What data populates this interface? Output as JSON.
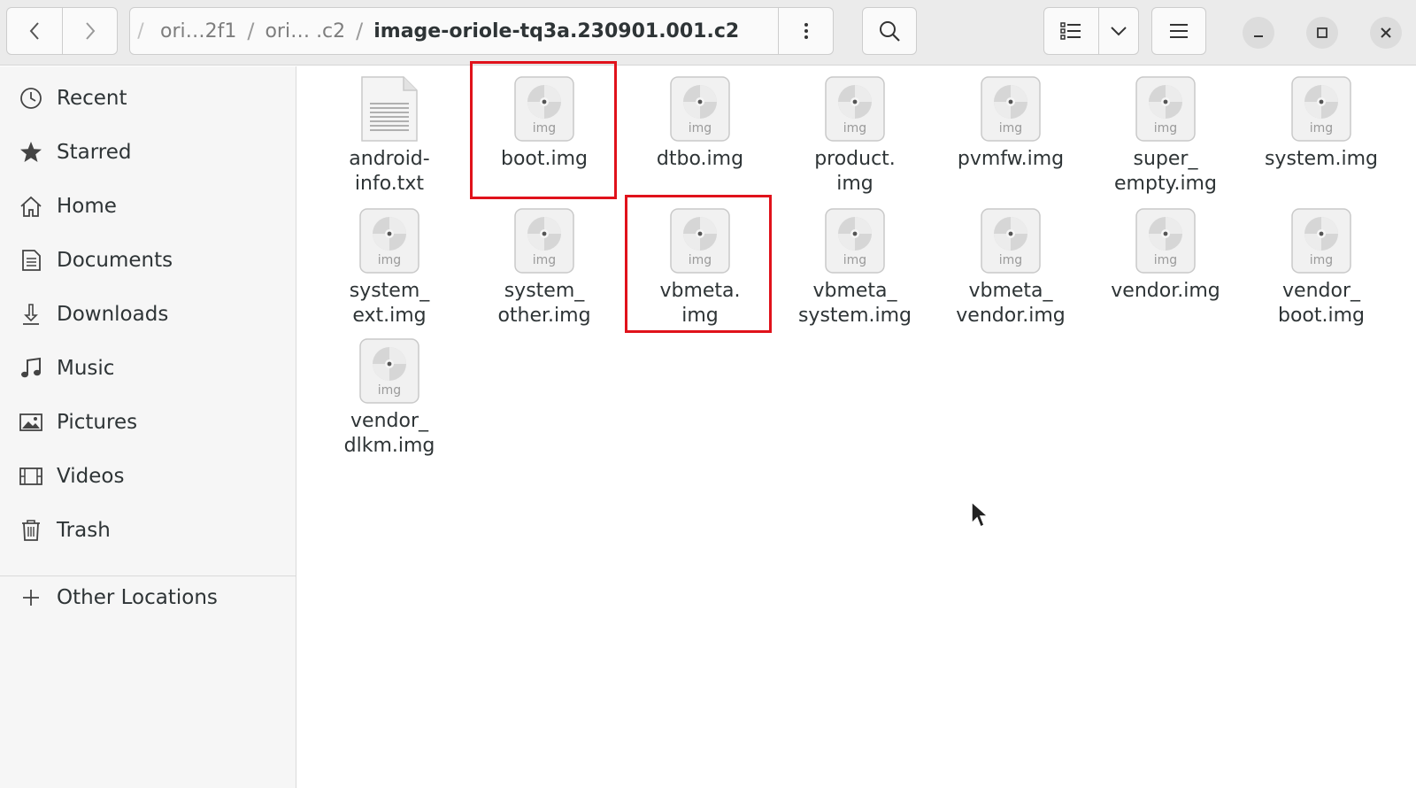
{
  "header": {
    "breadcrumbs": [
      "ori…2f1",
      "ori… .c2",
      "image-oriole-tq3a.230901.001.c2"
    ],
    "separator": "/"
  },
  "sidebar": {
    "items": [
      {
        "label": "Recent",
        "icon": "clock-icon"
      },
      {
        "label": "Starred",
        "icon": "star-icon"
      },
      {
        "label": "Home",
        "icon": "home-icon"
      },
      {
        "label": "Documents",
        "icon": "document-icon"
      },
      {
        "label": "Downloads",
        "icon": "download-icon"
      },
      {
        "label": "Music",
        "icon": "music-note-icon"
      },
      {
        "label": "Pictures",
        "icon": "picture-icon"
      },
      {
        "label": "Videos",
        "icon": "film-icon"
      },
      {
        "label": "Trash",
        "icon": "trash-icon"
      }
    ],
    "other_locations": {
      "label": "Other Locations",
      "icon": "plus-icon"
    }
  },
  "files": [
    {
      "name": "android-\ninfo.txt",
      "type": "text",
      "icon_label": ""
    },
    {
      "name": "boot.img",
      "type": "img",
      "icon_label": "img"
    },
    {
      "name": "dtbo.img",
      "type": "img",
      "icon_label": "img"
    },
    {
      "name": "product.\nimg",
      "type": "img",
      "icon_label": "img"
    },
    {
      "name": "pvmfw.img",
      "type": "img",
      "icon_label": "img"
    },
    {
      "name": "super_\nempty.img",
      "type": "img",
      "icon_label": "img"
    },
    {
      "name": "system.img",
      "type": "img",
      "icon_label": "img"
    },
    {
      "name": "system_\next.img",
      "type": "img",
      "icon_label": "img"
    },
    {
      "name": "system_\nother.img",
      "type": "img",
      "icon_label": "img"
    },
    {
      "name": "vbmeta.\nimg",
      "type": "img",
      "icon_label": "img"
    },
    {
      "name": "vbmeta_\nsystem.img",
      "type": "img",
      "icon_label": "img"
    },
    {
      "name": "vbmeta_\nvendor.img",
      "type": "img",
      "icon_label": "img"
    },
    {
      "name": "vendor.img",
      "type": "img",
      "icon_label": "img"
    },
    {
      "name": "vendor_\nboot.img",
      "type": "img",
      "icon_label": "img"
    },
    {
      "name": "vendor_\ndlkm.img",
      "type": "img",
      "icon_label": "img"
    }
  ],
  "highlighted_files": [
    "boot.img",
    "vbmeta.img"
  ],
  "colors": {
    "highlight": "#e0121b",
    "sidebar_bg": "#f6f6f6",
    "header_bg": "#ebebeb"
  }
}
